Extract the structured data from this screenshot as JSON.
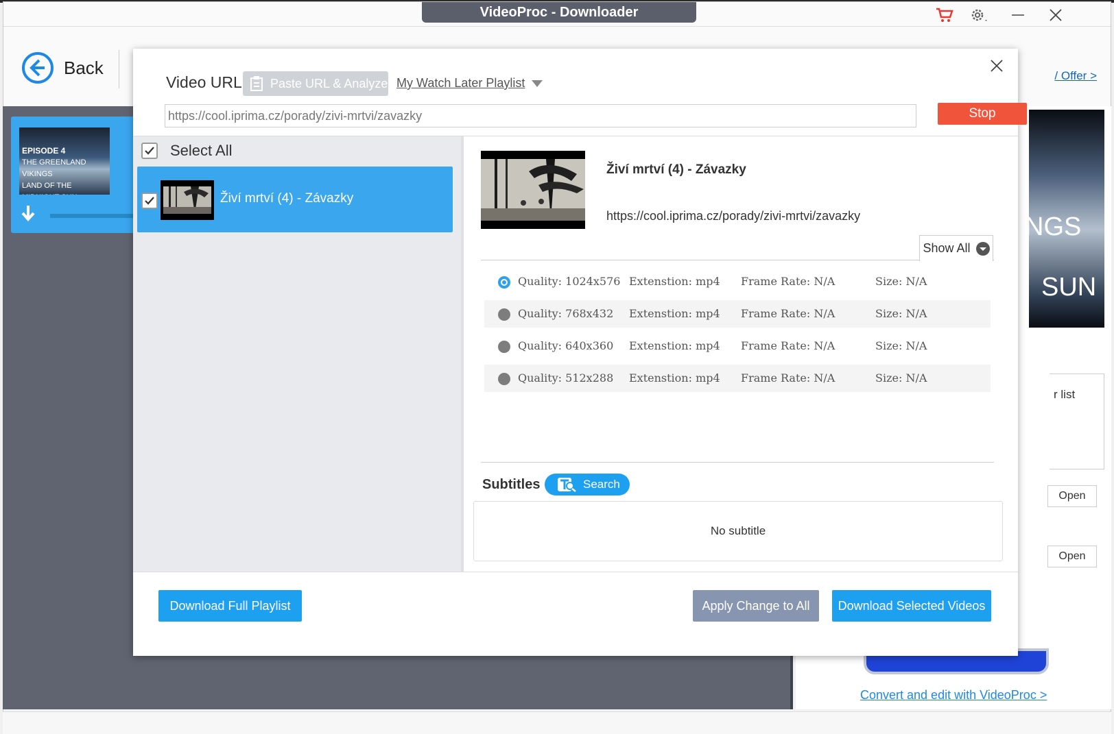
{
  "app": {
    "title": "VideoProc - Downloader",
    "back_label": "Back",
    "offer_link": "/ Offer >",
    "task_card": {
      "thumb_line1": "EPISODE 4",
      "thumb_line2": "THE GREENLAND VIKINGS",
      "thumb_line3": "LAND OF THE MIDNIGHT SUN"
    },
    "preview_text": [
      "NGS",
      "SUN"
    ],
    "side_box_text": "r list",
    "open_buttons": [
      "Open",
      "Open"
    ],
    "convert_link": "Convert and edit with VideoProc >"
  },
  "dialog": {
    "url_label": "Video URL:",
    "paste_button": "Paste URL & Analyze",
    "watch_later": "My Watch Later Playlist",
    "url_value": "https://cool.iprima.cz/porady/zivi-mrtvi/zavazky",
    "stop_button": "Stop",
    "select_all_label": "Select All",
    "select_all_checked": true,
    "videos": [
      {
        "title": "Živí mrtví (4) - Závazky",
        "checked": true
      }
    ],
    "detail": {
      "title": "Živí mrtví (4) - Závazky",
      "url": "https://cool.iprima.cz/porady/zivi-mrtvi/zavazky",
      "show_all": "Show All"
    },
    "formats": [
      {
        "quality": "Quality: 1024x576",
        "extension": "Extenstion: mp4",
        "frame_rate": "Frame Rate: N/A",
        "size": "Size: N/A",
        "selected": true
      },
      {
        "quality": "Quality: 768x432",
        "extension": "Extenstion: mp4",
        "frame_rate": "Frame Rate: N/A",
        "size": "Size: N/A",
        "selected": false
      },
      {
        "quality": "Quality: 640x360",
        "extension": "Extenstion: mp4",
        "frame_rate": "Frame Rate: N/A",
        "size": "Size: N/A",
        "selected": false
      },
      {
        "quality": "Quality: 512x288",
        "extension": "Extenstion: mp4",
        "frame_rate": "Frame Rate: N/A",
        "size": "Size: N/A",
        "selected": false
      }
    ],
    "subtitles": {
      "label": "Subtitles",
      "search_button": "Search",
      "empty_text": "No subtitle"
    },
    "footer": {
      "download_full": "Download Full Playlist",
      "apply_change": "Apply Change to All",
      "download_selected": "Download Selected Videos"
    }
  },
  "colors": {
    "accent": "#1ea0f0",
    "stop": "#f0553b",
    "apply": "#8795b0",
    "selected_item": "#3aa6ee"
  }
}
